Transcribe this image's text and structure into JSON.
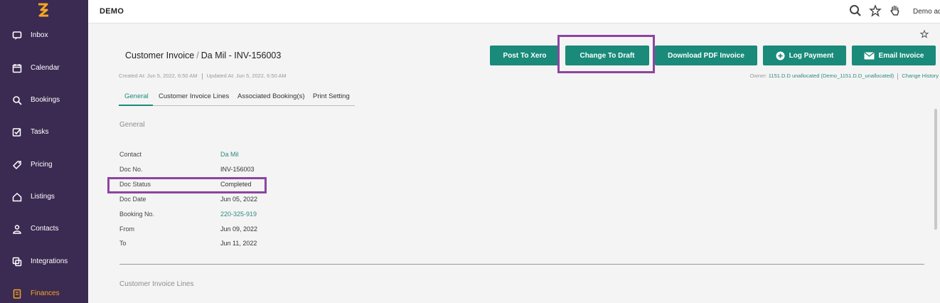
{
  "app": {
    "brand": "DEMO",
    "user": "Demo ad"
  },
  "sidebar": {
    "items": [
      {
        "label": "Inbox",
        "icon": "inbox-icon"
      },
      {
        "label": "Calendar",
        "icon": "calendar-icon"
      },
      {
        "label": "Bookings",
        "icon": "bookings-icon"
      },
      {
        "label": "Tasks",
        "icon": "tasks-icon"
      },
      {
        "label": "Pricing",
        "icon": "tag-icon"
      },
      {
        "label": "Listings",
        "icon": "home-icon"
      },
      {
        "label": "Contacts",
        "icon": "contacts-icon"
      },
      {
        "label": "Integrations",
        "icon": "integrations-icon"
      },
      {
        "label": "Finances",
        "icon": "finances-icon",
        "active": true
      }
    ]
  },
  "page": {
    "breadcrumb_root": "Customer Invoice",
    "breadcrumb_sep": "/",
    "breadcrumb_current": "Da Mil - INV-156003",
    "created": "Created At: Jun 5, 2022, 6:50 AM",
    "updated": "Updated At: Jun 5, 2022, 6:50 AM",
    "owner_prefix": "Owner:",
    "owner_value": "1151.D.D unallocated (Demo_1151.D.D_unallocated)",
    "change_history": "Change History"
  },
  "actions": {
    "post_to_xero": "Post To Xero",
    "change_to_draft": "Change To Draft",
    "download_pdf": "Download PDF Invoice",
    "log_payment": "Log Payment",
    "email_invoice": "Email Invoice"
  },
  "tabs": [
    "General",
    "Customer Invoice Lines",
    "Associated Booking(s)",
    "Print Setting"
  ],
  "general": {
    "section_title": "General",
    "fields": [
      {
        "label": "Contact",
        "value": "Da Mil",
        "link": true
      },
      {
        "label": "Doc No.",
        "value": "INV-156003"
      },
      {
        "label": "Doc Status",
        "value": "Completed"
      },
      {
        "label": "Doc Date",
        "value": "Jun 05, 2022"
      },
      {
        "label": "Booking No.",
        "value": "220-325-919",
        "link": true
      },
      {
        "label": "From",
        "value": "Jun 09, 2022"
      },
      {
        "label": "To",
        "value": "Jun 11, 2022"
      }
    ]
  },
  "lines_section": {
    "title": "Customer Invoice Lines"
  },
  "colors": {
    "sidebar": "#3b2a52",
    "accent": "#1a8a7a",
    "highlight": "#8e44a0",
    "active_nav": "#f5a623"
  }
}
